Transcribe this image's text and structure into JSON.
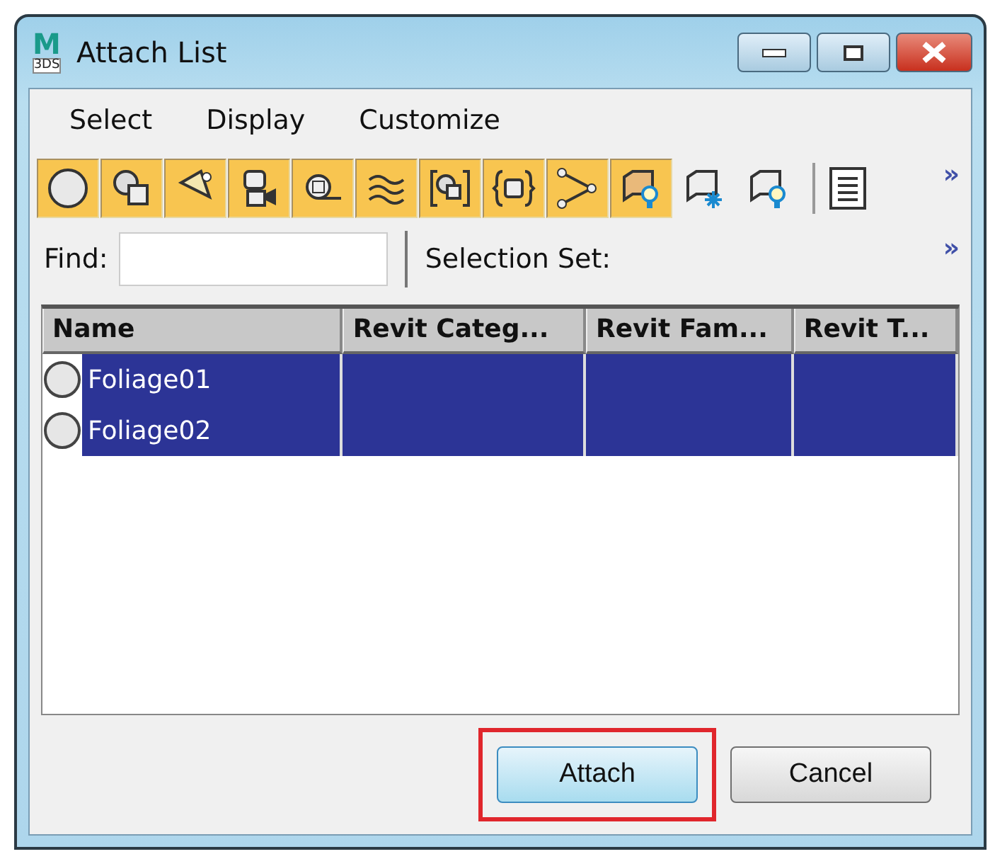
{
  "window": {
    "title": "Attach List",
    "logo": [
      "M",
      "3DS"
    ]
  },
  "menu": [
    "Select",
    "Display",
    "Customize"
  ],
  "toolbar": [
    {
      "on": true
    },
    {
      "on": true
    },
    {
      "on": true
    },
    {
      "on": true
    },
    {
      "on": true
    },
    {
      "on": true
    },
    {
      "on": true
    },
    {
      "on": true
    },
    {
      "on": true
    },
    {
      "on": true
    },
    {
      "on": false
    },
    {
      "on": false
    }
  ],
  "overflow": [
    "»",
    "»"
  ],
  "find": {
    "label": "Find:"
  },
  "selection_set": {
    "label": "Selection Set:"
  },
  "table": {
    "columns": [
      "Name",
      "Revit Categ...",
      "Revit Fam...",
      "Revit T..."
    ],
    "rows": [
      {
        "name": "Foliage01",
        "selected": true
      },
      {
        "name": "Foliage02",
        "selected": true
      }
    ]
  },
  "buttons": [
    {
      "label": "Attach",
      "highlighted": true
    },
    {
      "label": "Cancel",
      "highlighted": false
    }
  ]
}
